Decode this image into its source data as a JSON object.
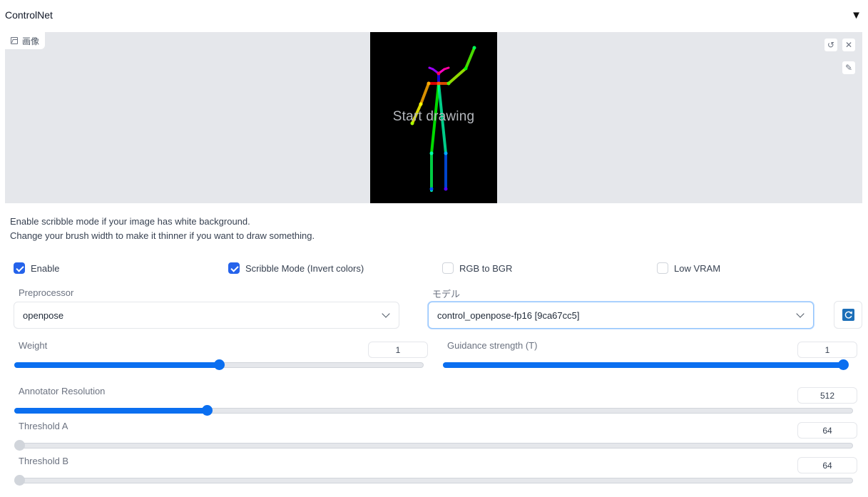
{
  "panel": {
    "title": "ControlNet",
    "collapse_icon": "▼"
  },
  "image_input": {
    "tab_label": "画像",
    "placeholder_text": "Start drawing"
  },
  "help_text": [
    "Enable scribble mode if your image has white background.",
    "Change your brush width to make it thinner if you want to draw something."
  ],
  "checkboxes": {
    "enable": {
      "label": "Enable",
      "checked": true
    },
    "scribble": {
      "label": "Scribble Mode (Invert colors)",
      "checked": true
    },
    "rgb_bgr": {
      "label": "RGB to BGR",
      "checked": false
    },
    "low_vram": {
      "label": "Low VRAM",
      "checked": false
    }
  },
  "preprocessor": {
    "label": "Preprocessor",
    "value": "openpose"
  },
  "model": {
    "label": "モデル",
    "value": "control_openpose-fp16 [9ca67cc5]"
  },
  "sliders": {
    "weight": {
      "label": "Weight",
      "value": "1",
      "fraction": 0.5
    },
    "guidance": {
      "label": "Guidance strength (T)",
      "value": "1",
      "fraction": 1.0
    },
    "annotator": {
      "label": "Annotator Resolution",
      "value": "512",
      "fraction": 0.226
    },
    "threshold_a": {
      "label": "Threshold A",
      "value": "64",
      "fraction": 0.0
    },
    "threshold_b": {
      "label": "Threshold B",
      "value": "64",
      "fraction": 0.0
    }
  },
  "colors": {
    "accent": "#0b6ff0",
    "checkbox": "#2563eb",
    "canvas_bg": "#e5e7eb"
  }
}
